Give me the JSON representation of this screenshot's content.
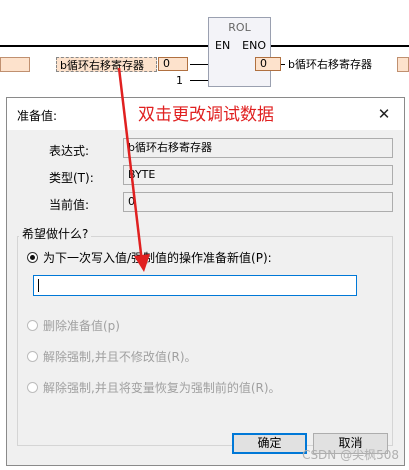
{
  "background": {
    "function_block": {
      "name": "ROL",
      "en": "EN",
      "eno": "ENO"
    },
    "left_var": "b循环右移寄存器",
    "left_value": "0",
    "right_var": "b循环右移寄存器",
    "right_value": "0",
    "constant": "1"
  },
  "annotation": "双击更改调试数据",
  "dialog": {
    "title": "准备值:",
    "expression_label": "表达式:",
    "expression_value": "b循环右移寄存器",
    "type_label": "类型(T):",
    "type_value": "BYTE",
    "current_label": "当前值:",
    "current_value": "0",
    "group_label": "希望做什么?",
    "options": [
      {
        "label": "为下一次写入值/强制值的操作准备新值(P):",
        "checked": true,
        "enabled": true
      },
      {
        "label": "删除准备值(p)",
        "checked": false,
        "enabled": false
      },
      {
        "label": "解除强制,并且不修改值(R)。",
        "checked": false,
        "enabled": false
      },
      {
        "label": "解除强制,并且将变量恢复为强制前的值(R)。",
        "checked": false,
        "enabled": false
      }
    ],
    "new_value": "",
    "ok_label": "确定",
    "cancel_label": "取消"
  },
  "watermark": "CSDN @尖枫508",
  "colors": {
    "annotation": "#e02020",
    "focus": "#0078d7",
    "var_bg": "#fde2cc"
  }
}
